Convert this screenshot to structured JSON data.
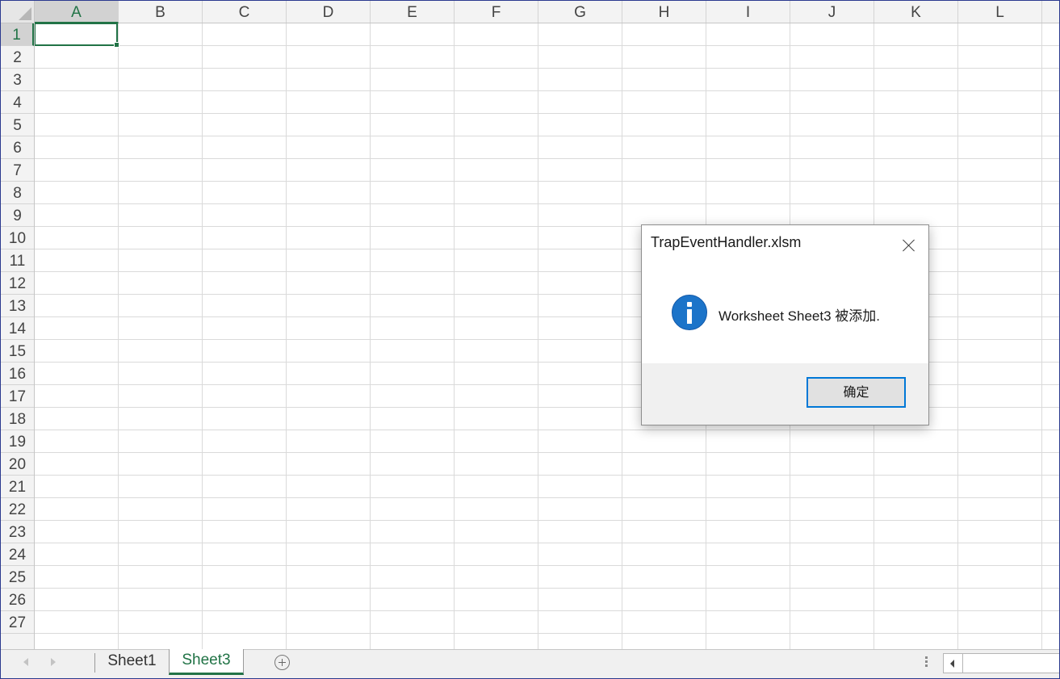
{
  "spreadsheet": {
    "columns": [
      "A",
      "B",
      "C",
      "D",
      "E",
      "F",
      "G",
      "H",
      "I",
      "J",
      "K",
      "L"
    ],
    "rows": [
      "1",
      "2",
      "3",
      "4",
      "5",
      "6",
      "7",
      "8",
      "9",
      "10",
      "11",
      "12",
      "13",
      "14",
      "15",
      "16",
      "17",
      "18",
      "19",
      "20",
      "21",
      "22",
      "23",
      "24",
      "25",
      "26",
      "27"
    ],
    "active_cell": "A1"
  },
  "sheet_tabs": {
    "tabs": [
      "Sheet1",
      "Sheet3"
    ],
    "active": "Sheet3"
  },
  "dialog": {
    "title": "TrapEventHandler.xlsm",
    "icon": "info-icon",
    "message": "Worksheet Sheet3 被添加.",
    "ok_label": "确定"
  },
  "colors": {
    "accent": "#217346",
    "dialog_button_border": "#0078d7",
    "info_icon": "#1c74c9"
  }
}
